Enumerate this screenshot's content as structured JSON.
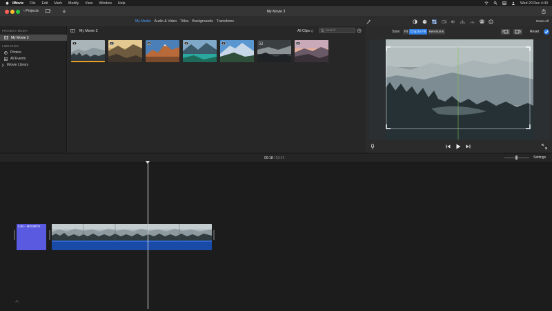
{
  "menubar": {
    "items": [
      "iMovie",
      "File",
      "Edit",
      "Mark",
      "Modify",
      "View",
      "Window",
      "Help"
    ],
    "clock": "Wed 20 Dec  4:40"
  },
  "titlebar": {
    "projects_label": "‹ Projects",
    "title": "My Movie 3"
  },
  "media_tabs": [
    "My Media",
    "Audio & Video",
    "Titles",
    "Backgrounds",
    "Transitions"
  ],
  "reset_all": "Reset All",
  "sidebar": {
    "project_header": "PROJECT MEDIA",
    "project_item": "My Movie 3",
    "libraries_header": "LIBRARIES",
    "items": [
      "Photos",
      "All Events",
      "iMovie Library"
    ]
  },
  "browser": {
    "title": "My Movie 3",
    "filter": "All Clips ◇",
    "search_placeholder": "Search"
  },
  "viewer": {
    "style_label": "Style:",
    "styles": [
      "Fit",
      "Crop to Fill",
      "Ken Burns"
    ],
    "reset": "Reset"
  },
  "timeline": {
    "current": "00:18",
    "total": "/ 03:24",
    "settings": "Settings",
    "title_clip": "4.0s – MOUNTAI"
  },
  "colors": {
    "accent": "#2f7fe6",
    "title_clip": "#5a5ae0",
    "audio": "#1a4aa8"
  }
}
